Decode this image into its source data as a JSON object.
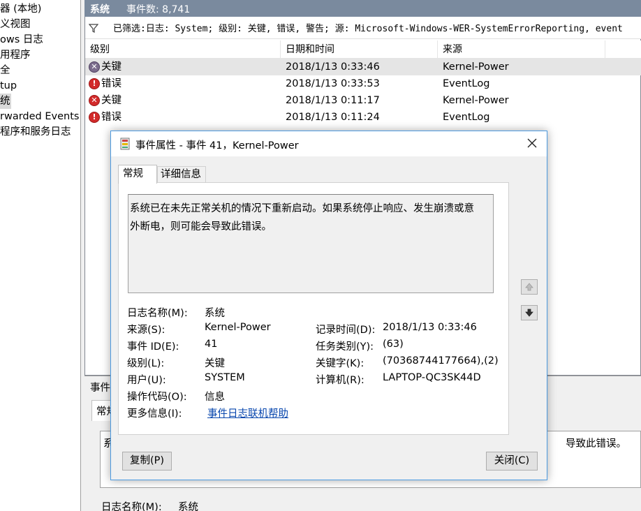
{
  "left_tree": {
    "items": [
      {
        "label": "器 (本地)"
      },
      {
        "label": "义视图"
      },
      {
        "label": "ows 日志"
      },
      {
        "label": "用程序"
      },
      {
        "label": "全"
      },
      {
        "label": "tup"
      },
      {
        "label": "统"
      },
      {
        "label": "rwarded Events"
      },
      {
        "label": "程序和服务日志"
      }
    ]
  },
  "main": {
    "header_title": "系统",
    "header_count": "事件数: 8,741",
    "filter_text": "已筛选:日志: System; 级别: 关键, 错误, 警告; 源: Microsoft-Windows-WER-SystemErrorReporting, event",
    "columns": [
      "级别",
      "日期和时间",
      "来源"
    ],
    "rows": [
      {
        "level": "关键",
        "level_type": "critical",
        "datetime": "2018/1/13 0:33:46",
        "source": "Kernel-Power"
      },
      {
        "level": "错误",
        "level_type": "error",
        "datetime": "2018/1/13 0:33:53",
        "source": "EventLog"
      },
      {
        "level": "关键",
        "level_type": "critical-red",
        "datetime": "2018/1/13 0:11:17",
        "source": "Kernel-Power"
      },
      {
        "level": "错误",
        "level_type": "error",
        "datetime": "2018/1/13 0:11:24",
        "source": "EventLog"
      }
    ]
  },
  "lower_panel": {
    "title": "事件",
    "tab": "常规",
    "text_start": "系",
    "text_end": "导致此错误。",
    "field_label": "日志名称(M):",
    "field_value": "系统"
  },
  "dialog": {
    "title": "事件属性 - 事件 41，Kernel-Power",
    "tabs": {
      "general": "常规",
      "details": "详细信息"
    },
    "description": {
      "line1": "系统已在未先正常关机的情况下重新启动。如果系统停止响应、发生崩溃或意",
      "line2": "外断电，则可能会导致此错误。"
    },
    "fields": {
      "log_name_label": "日志名称(M):",
      "log_name_value": "系统",
      "source_label": "来源(S):",
      "source_value": "Kernel-Power",
      "logged_label": "记录时间(D):",
      "logged_value": "2018/1/13 0:33:46",
      "event_id_label": "事件 ID(E):",
      "event_id_value": "41",
      "task_label": "任务类别(Y):",
      "task_value": "(63)",
      "level_label": "级别(L):",
      "level_value": "关键",
      "keywords_label": "关键字(K):",
      "keywords_value": "(70368744177664),(2)",
      "user_label": "用户(U):",
      "user_value": "SYSTEM",
      "computer_label": "计算机(R):",
      "computer_value": "LAPTOP-QC3SK44D",
      "opcode_label": "操作代码(O):",
      "opcode_value": "信息",
      "more_info_label": "更多信息(I):",
      "more_info_link": "事件日志联机帮助"
    },
    "buttons": {
      "copy": "复制(P)",
      "close": "关闭(C)"
    }
  }
}
